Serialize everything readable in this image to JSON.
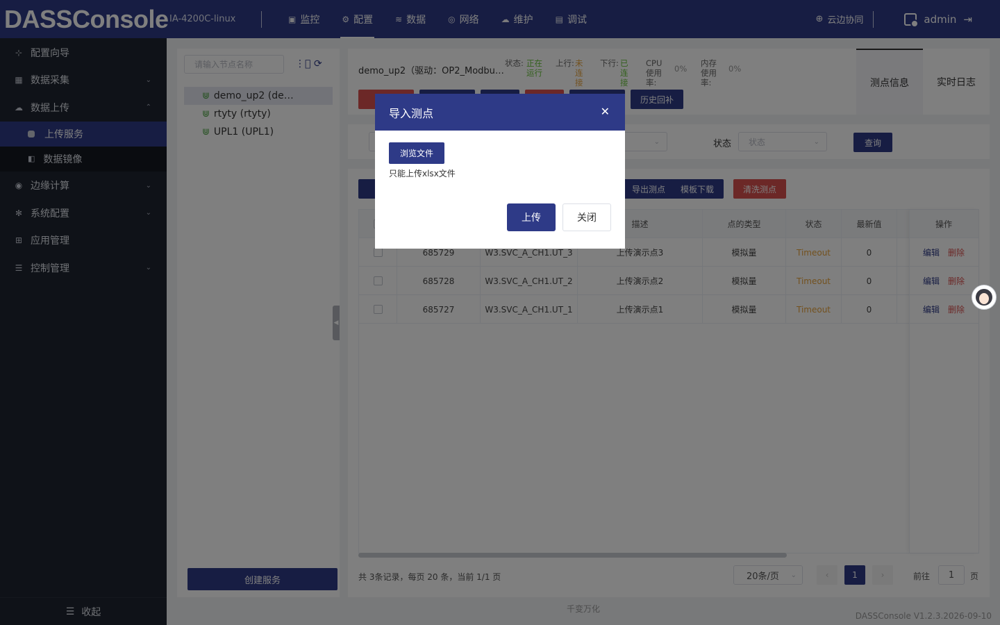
{
  "app": {
    "logo": "DASSConsole",
    "device": "IA-4200C-linux",
    "nav": [
      {
        "label": "监控",
        "icon": "monitor-icon"
      },
      {
        "label": "配置",
        "icon": "gear-icon"
      },
      {
        "label": "数据",
        "icon": "database-icon"
      },
      {
        "label": "网络",
        "icon": "network-icon"
      },
      {
        "label": "维护",
        "icon": "cloud-icon"
      },
      {
        "label": "调试",
        "icon": "debug-icon"
      }
    ],
    "active_nav": "配置",
    "cloud_label": "云边协同",
    "user": "admin"
  },
  "sidebar": {
    "items": [
      {
        "label": "配置向导",
        "icon": "wizard-icon"
      },
      {
        "label": "数据采集",
        "icon": "collect-icon"
      },
      {
        "label": "数据上传",
        "icon": "upload-cloud-icon"
      },
      {
        "label": "边缘计算",
        "icon": "edge-icon"
      },
      {
        "label": "系统配置",
        "icon": "settings-icon"
      },
      {
        "label": "应用管理",
        "icon": "apps-icon"
      },
      {
        "label": "控制管理",
        "icon": "sliders-icon"
      }
    ],
    "sub_items": [
      {
        "label": "上传服务"
      },
      {
        "label": "数据镜像"
      }
    ],
    "collapse_label": "收起"
  },
  "tree": {
    "search_placeholder": "请输入节点名称",
    "nodes": [
      {
        "label": "demo_up2 (de…"
      },
      {
        "label": "rtyty (rtyty)"
      },
      {
        "label": "UPL1 (UPL1)"
      }
    ],
    "create_label": "创建服务"
  },
  "service": {
    "title": "demo_up2（驱动：OP2_Modbu…",
    "status_label": "状态:",
    "status_value": "正在运行",
    "up_label": "上行:",
    "up_value": "未连接",
    "down_label": "下行:",
    "down_value": "已连接",
    "cpu_label": "CPU使用率:",
    "cpu_value": "0%",
    "mem_label": "内存使用率:",
    "mem_value": "0%",
    "history_btn": "历史回补",
    "tabs": [
      "测点信息",
      "实时日志"
    ],
    "colors": {
      "running": "#67c23a",
      "disconnected": "#e6a23c",
      "connected": "#67c23a"
    }
  },
  "filter": {
    "status_label": "状态",
    "status_placeholder": "状态",
    "query_label": "查询"
  },
  "table": {
    "buttons": {
      "export_label": "导出测点",
      "template_label": "模板下载",
      "clear_label": "清洗测点"
    },
    "columns": [
      "描述",
      "点的类型",
      "状态",
      "最新值",
      "操作"
    ],
    "rows": [
      {
        "id": "685729",
        "tag": "W3.SVC_A_CH1.UT_3",
        "desc": "上传演示点3",
        "type": "模拟量",
        "status": "Timeout",
        "value": "0"
      },
      {
        "id": "685728",
        "tag": "W3.SVC_A_CH1.UT_2",
        "desc": "上传演示点2",
        "type": "模拟量",
        "status": "Timeout",
        "value": "0"
      },
      {
        "id": "685727",
        "tag": "W3.SVC_A_CH1.UT_1",
        "desc": "上传演示点1",
        "type": "模拟量",
        "status": "Timeout",
        "value": "0"
      }
    ],
    "edit_label": "编辑",
    "delete_label": "删除"
  },
  "pager": {
    "summary": "共 3条记录，每页 20 条，当前 1/1 页",
    "page_size": "20条/页",
    "current_page": "1",
    "goto_label": "前往",
    "goto_value": "1",
    "goto_unit": "页"
  },
  "footer": {
    "company": "千变万化",
    "version": "DASSConsole V1.2.3.2026-09-10"
  },
  "dialog": {
    "title": "导入测点",
    "browse_label": "浏览文件",
    "tip": "只能上传xlsx文件",
    "upload_label": "上传",
    "close_label": "关闭"
  }
}
